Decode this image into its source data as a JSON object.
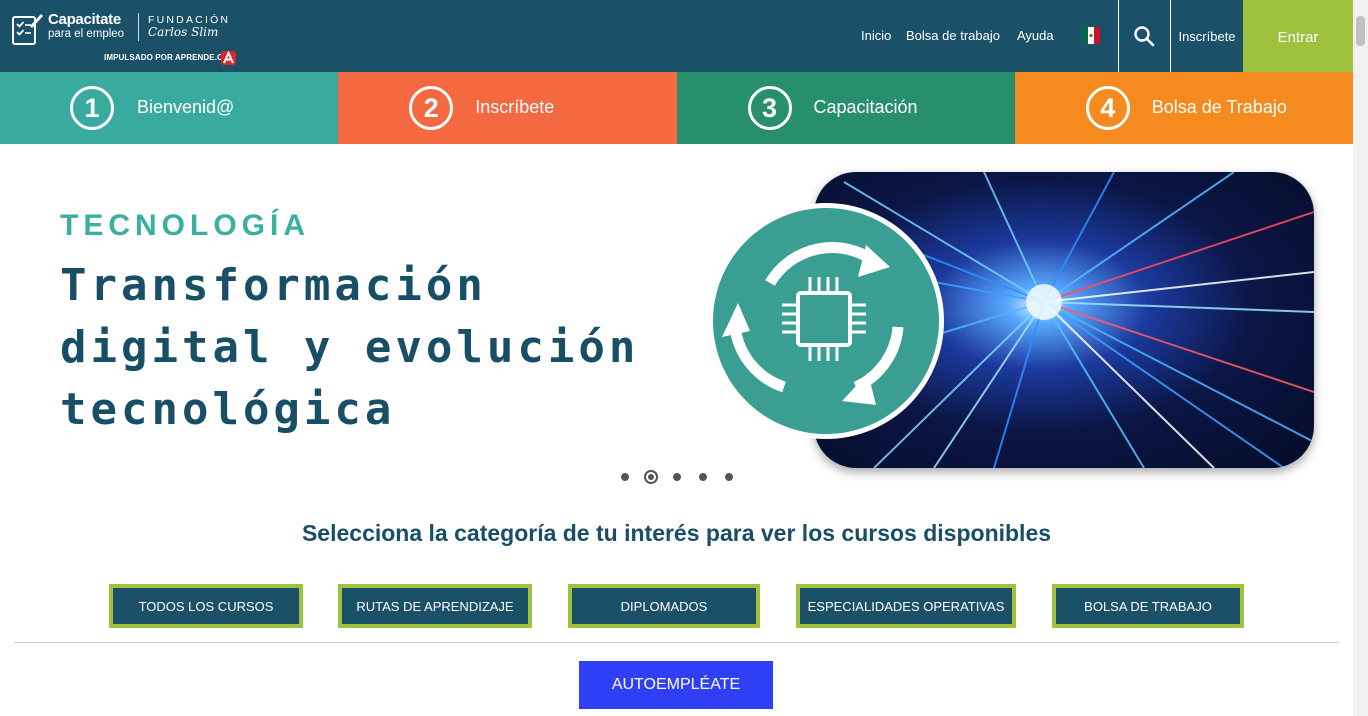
{
  "header": {
    "logo": {
      "line1": "Capacitate",
      "line2": "para el empleo",
      "foundation_line1": "FUNDACIÓN",
      "foundation_line2": "Carlos Slim",
      "powered_by": "IMPULSADO POR APRENDE.ORG"
    },
    "nav": {
      "inicio": "Inicio",
      "bolsa": "Bolsa de trabajo",
      "ayuda": "Ayuda"
    },
    "inscribete": "Inscríbete",
    "entrar": "Entrar",
    "colors": {
      "background": "#1a5168",
      "entrar": "#9ec23d"
    },
    "icons": [
      "mexico-flag-icon",
      "search-icon"
    ]
  },
  "steps": [
    {
      "number": "1",
      "label": "Bienvenid@",
      "color": "#38aa9e"
    },
    {
      "number": "2",
      "label": "Inscríbete",
      "color": "#f4693f"
    },
    {
      "number": "3",
      "label": "Capacitación",
      "color": "#278f6d"
    },
    {
      "number": "4",
      "label": "Bolsa de Trabajo",
      "color": "#f58a1e"
    }
  ],
  "hero": {
    "category": "TECNOLOGÍA",
    "title_line1": "Transformación",
    "title_line2": "digital y evolución",
    "title_line3": "tecnológica",
    "carousel": {
      "total": 5,
      "active_index": 1
    }
  },
  "categories": {
    "title": "Selecciona la categoría de tu interés para ver los cursos disponibles",
    "buttons": [
      "TODOS LOS CURSOS",
      "RUTAS DE APRENDIZAJE",
      "DIPLOMADOS",
      "ESPECIALIDADES OPERATIVAS",
      "BOLSA DE TRABAJO"
    ]
  },
  "autoempleate": "AUTOEMPLÉATE"
}
